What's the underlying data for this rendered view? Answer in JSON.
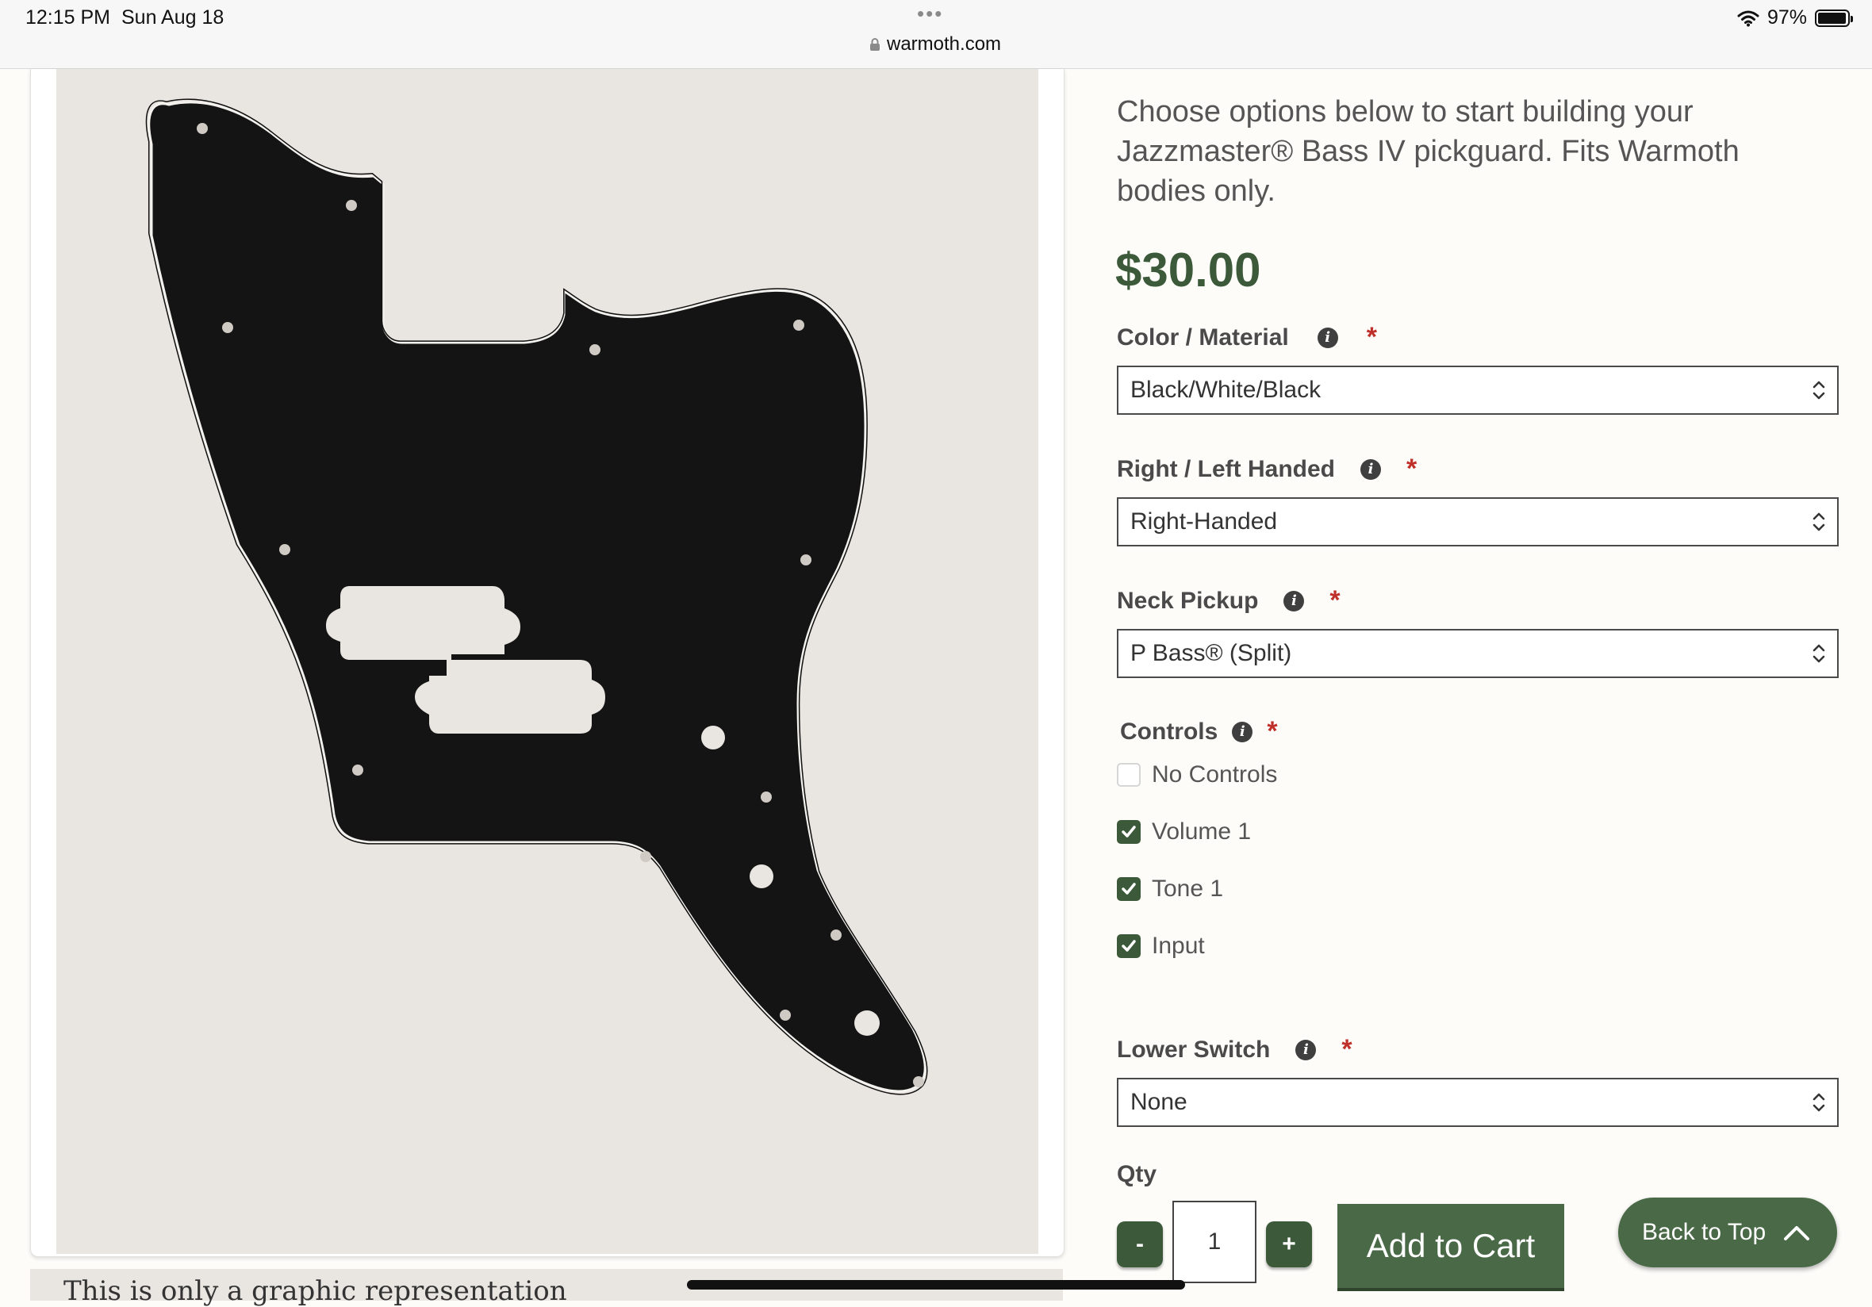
{
  "status_bar": {
    "time": "12:15 PM",
    "date": "Sun Aug 18",
    "url": "warmoth.com",
    "battery": "97%",
    "battery_level": 0.97
  },
  "product": {
    "description": "Choose options below to start building your Jazzmaster® Bass IV pickguard. Fits Warmoth bodies only.",
    "price": "$30.00",
    "image_caption": "This is only a graphic representation",
    "pickguard_color": "#141414",
    "background_color": "#e9e5e0"
  },
  "options": {
    "color_material": {
      "label": "Color / Material",
      "value": "Black/White/Black"
    },
    "handedness": {
      "label": "Right / Left Handed",
      "value": "Right-Handed"
    },
    "neck_pickup": {
      "label": "Neck Pickup",
      "value": "P Bass® (Split)"
    },
    "controls": {
      "label": "Controls",
      "items": [
        {
          "label": "No Controls",
          "checked": false
        },
        {
          "label": "Volume 1",
          "checked": true
        },
        {
          "label": "Tone 1",
          "checked": true
        },
        {
          "label": "Input",
          "checked": true
        }
      ]
    },
    "lower_switch": {
      "label": "Lower Switch",
      "value": "None"
    },
    "required_mark": "*"
  },
  "cart": {
    "qty_label": "Qty",
    "qty_value": "1",
    "minus": "-",
    "plus": "+",
    "add_label": "Add to Cart",
    "back_to_top": "Back to Top"
  },
  "theme": {
    "accent": "#3c5a3a",
    "button": "#4a6a47",
    "required": "#c0302b"
  }
}
